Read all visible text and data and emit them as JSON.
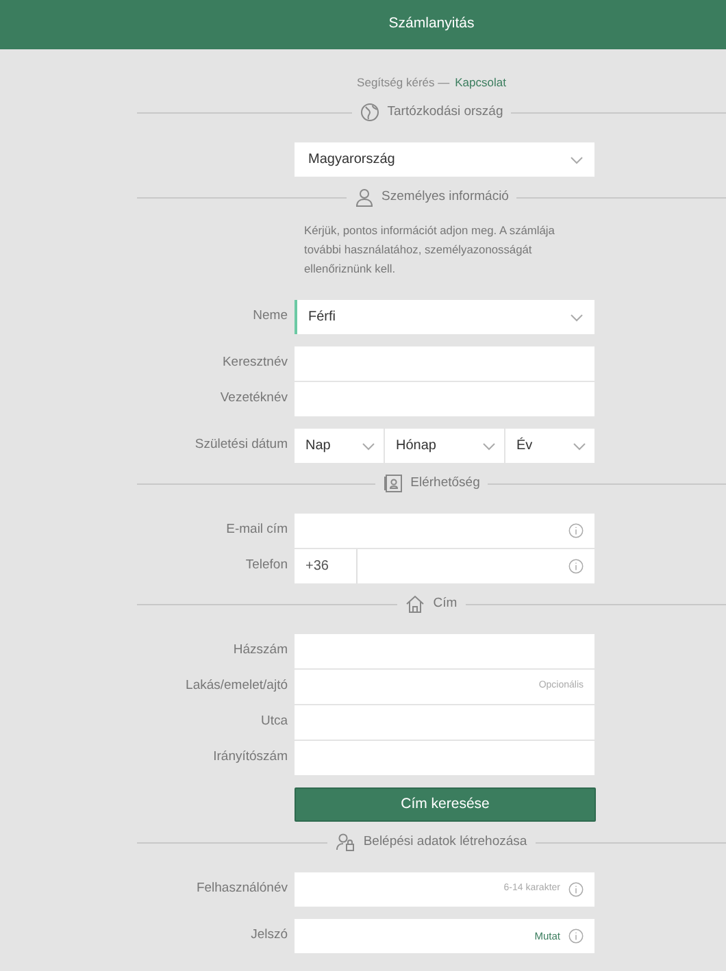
{
  "header": {
    "title": "Számlanyitás"
  },
  "help": {
    "text": "Segítség kérés —",
    "link": "Kapcsolat"
  },
  "sections": [
    {
      "title": "Tartózkodási ország",
      "groups": [
        [
          {
            "kind": "select",
            "value": "Magyarország",
            "focused": false
          }
        ]
      ]
    },
    {
      "title": "Személyes információ",
      "note": "Kérjük, pontos információt adjon meg. A számlája további használatához, személyazonosságát ellenőriznünk kell.",
      "groups": [
        [
          {
            "kind": "select",
            "label": "Neme",
            "value": "Férfi",
            "focused": true
          }
        ],
        [
          {
            "kind": "text",
            "label": "Keresztnév",
            "info": false
          },
          {
            "kind": "text",
            "label": "Vezetéknév",
            "info": false
          }
        ],
        [
          {
            "kind": "date",
            "label": "Születési dátum",
            "parts": [
              "Nap",
              "Hónap",
              "Év"
            ]
          }
        ]
      ]
    },
    {
      "title": "Elérhetőség",
      "groups": [
        [
          {
            "kind": "text",
            "label": "E-mail cím",
            "info": true
          },
          {
            "kind": "phone",
            "label": "Telefon",
            "prefix": "+36",
            "info": true
          }
        ]
      ]
    },
    {
      "title": "Cím",
      "groups": [
        [
          {
            "kind": "text",
            "label": "Házszám",
            "info": false
          },
          {
            "kind": "text",
            "label": "Lakás/emelet/ajtó",
            "hint": "Opcionális",
            "info": false
          },
          {
            "kind": "text",
            "label": "Utca",
            "info": false
          },
          {
            "kind": "text",
            "label": "Irányítószám",
            "info": false
          }
        ],
        [
          {
            "kind": "button",
            "label": "Cím keresése"
          }
        ]
      ]
    },
    {
      "title": "Belépési adatok létrehozása",
      "groups": [
        [
          {
            "kind": "text",
            "label": "Felhasználónév",
            "hint": "6-14 karakter",
            "info": true
          }
        ],
        [
          {
            "kind": "text",
            "label": "Jelszó",
            "link": "Mutat",
            "info": true
          }
        ]
      ]
    }
  ]
}
